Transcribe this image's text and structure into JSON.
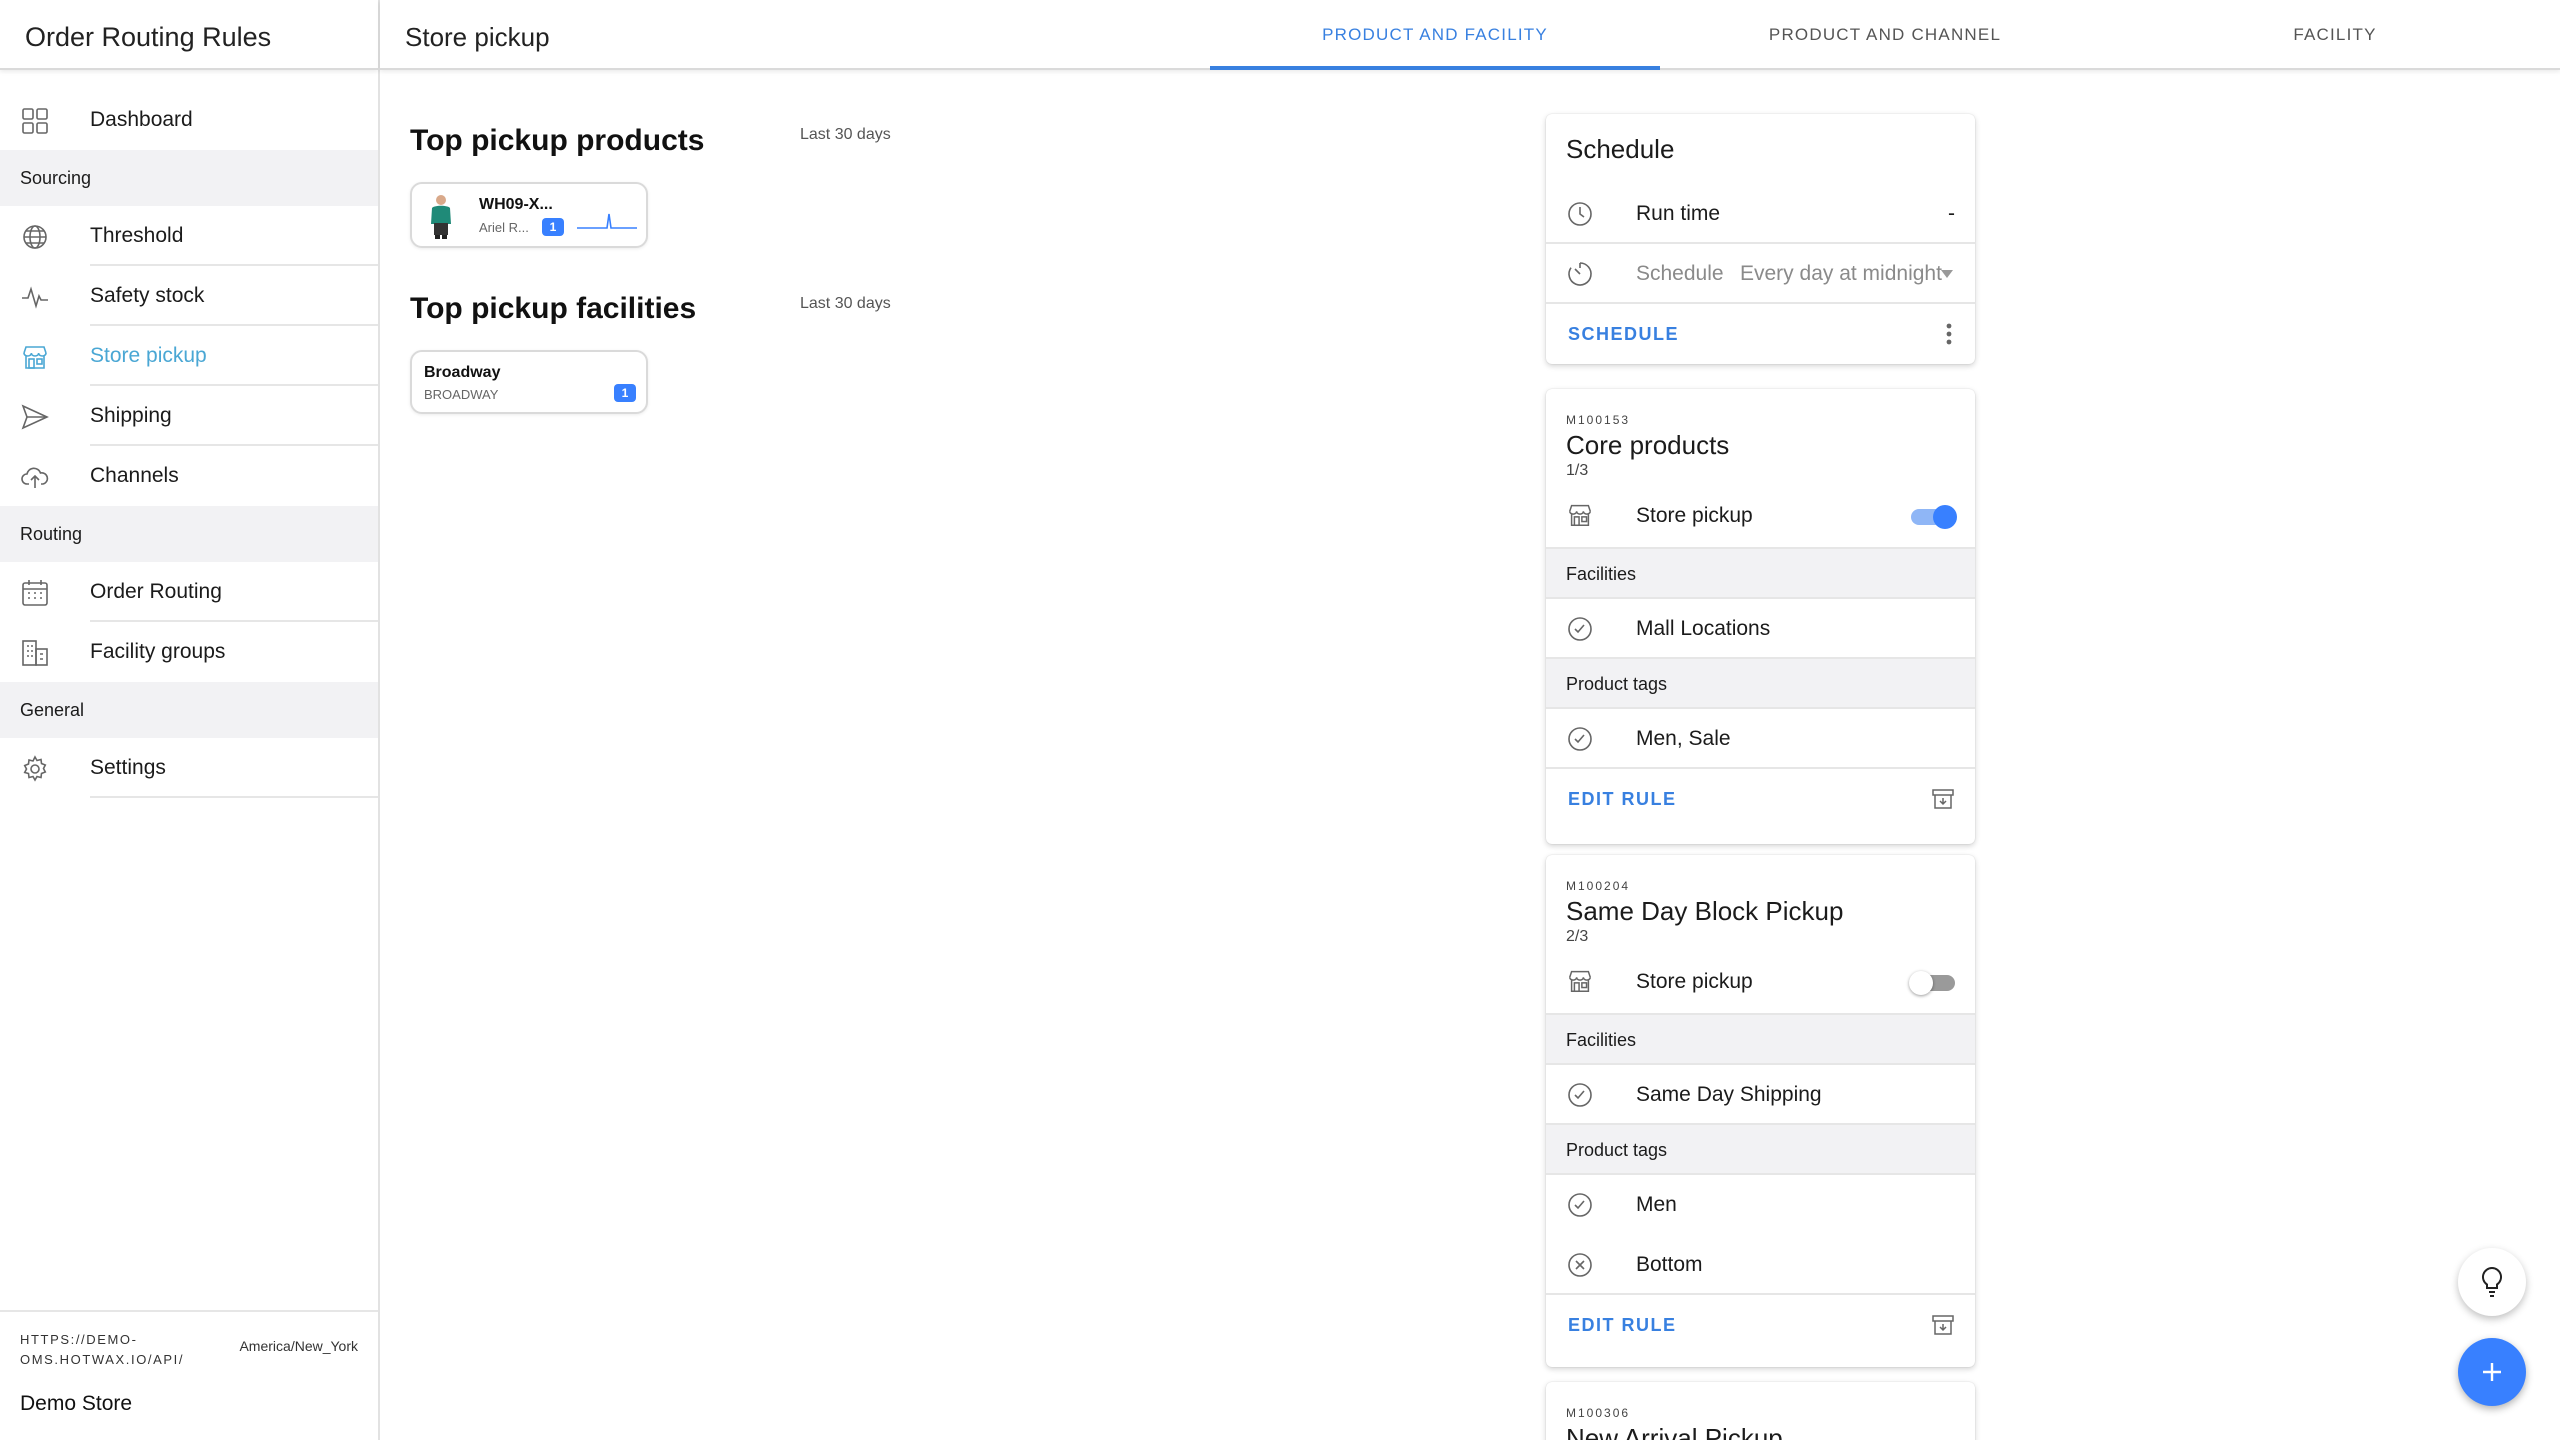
{
  "app": {
    "title": "Order Routing Rules"
  },
  "sidebar": {
    "items": [
      {
        "label": "Dashboard",
        "icon": "grid-icon"
      },
      {
        "group": "Sourcing"
      },
      {
        "label": "Threshold",
        "icon": "globe-icon"
      },
      {
        "label": "Safety stock",
        "icon": "pulse-icon"
      },
      {
        "label": "Store pickup",
        "icon": "storefront-icon",
        "active": true
      },
      {
        "label": "Shipping",
        "icon": "send-icon"
      },
      {
        "label": "Channels",
        "icon": "cloud-upload-icon"
      },
      {
        "group": "Routing"
      },
      {
        "label": "Order Routing",
        "icon": "calendar-icon"
      },
      {
        "label": "Facility groups",
        "icon": "business-icon"
      },
      {
        "group": "General"
      },
      {
        "label": "Settings",
        "icon": "gear-icon"
      }
    ],
    "footer": {
      "instance_url": "HTTPS://DEMO-OMS.HOTWAX.IO/API/",
      "timezone": "America/New_York",
      "store": "Demo Store"
    }
  },
  "header": {
    "page_title": "Store pickup",
    "tabs": [
      {
        "label": "PRODUCT AND FACILITY",
        "active": true
      },
      {
        "label": "PRODUCT AND CHANNEL",
        "active": false
      },
      {
        "label": "FACILITY",
        "active": false
      }
    ]
  },
  "main": {
    "top_products": {
      "title": "Top pickup products",
      "period": "Last 30 days",
      "items": [
        {
          "name": "WH09-X...",
          "sub": "Ariel R...",
          "count": "1"
        }
      ]
    },
    "top_facilities": {
      "title": "Top pickup facilities",
      "period": "Last 30 days",
      "items": [
        {
          "name": "Broadway",
          "sub": "BROADWAY",
          "count": "1"
        }
      ]
    }
  },
  "schedule": {
    "title": "Schedule",
    "run_time_label": "Run time",
    "run_time_value": "-",
    "schedule_label": "Schedule",
    "schedule_value": "Every day at midnight",
    "action_label": "SCHEDULE"
  },
  "rules": [
    {
      "code": "M100153",
      "name": "Core products",
      "sequence": "1/3",
      "toggle_label": "Store pickup",
      "enabled": true,
      "facilities_label": "Facilities",
      "facilities": [
        {
          "label": "Mall Locations",
          "icon": "checkmark-circle-icon"
        }
      ],
      "tags_label": "Product tags",
      "tags": [
        {
          "label": "Men, Sale",
          "icon": "checkmark-circle-icon"
        }
      ],
      "edit_label": "EDIT RULE"
    },
    {
      "code": "M100204",
      "name": "Same Day Block Pickup",
      "sequence": "2/3",
      "toggle_label": "Store pickup",
      "enabled": false,
      "facilities_label": "Facilities",
      "facilities": [
        {
          "label": "Same Day Shipping",
          "icon": "checkmark-circle-icon"
        }
      ],
      "tags_label": "Product tags",
      "tags": [
        {
          "label": "Men",
          "icon": "checkmark-circle-icon"
        },
        {
          "label": "Bottom",
          "icon": "close-circle-icon"
        }
      ],
      "edit_label": "EDIT RULE"
    },
    {
      "code": "M100306",
      "name": "New Arrival Pickup"
    }
  ],
  "colors": {
    "accent": "#3880e0",
    "primary": "#3880ff",
    "active_nav": "#4aa7d4"
  }
}
